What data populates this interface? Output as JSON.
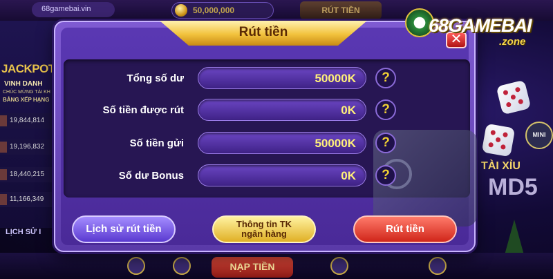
{
  "topbar": {
    "site": "68gamebai.vin",
    "balance": "50,000,000",
    "withdraw_tab": "RÚT TIỀN"
  },
  "left_panel": {
    "jackpot": "JACKPOT",
    "vinh_danh": "VINH DANH",
    "chuc_mung": "CHÚC MỪNG TÀI KH",
    "bang_xep_hang": "BẢNG XẾP HẠNG",
    "leaderboard": [
      "19,844,814",
      "19,196,832",
      "18,440,215",
      "11,166,349"
    ],
    "history": "LỊCH SỬ I"
  },
  "right_scene": {
    "tai_xiu": "TÀI XỈU",
    "md5": "MD5",
    "mini": "MINI"
  },
  "bottom_bar": {
    "nap_tien": "NẠP TIỀN"
  },
  "logo": {
    "brand": "68GAMEBAI",
    "suffix": ".zone"
  },
  "dialog": {
    "title": "Rút tiền",
    "close": "✕",
    "rows": [
      {
        "label": "Tổng số dư",
        "value": "50000K",
        "help": "?"
      },
      {
        "label": "Số tiền được rút",
        "value": "0K",
        "help": "?"
      },
      {
        "label": "Số tiền gửi",
        "value": "50000K",
        "help": "?"
      },
      {
        "label": "Số dư Bonus",
        "value": "0K",
        "help": "?"
      }
    ],
    "buttons": {
      "history": "Lịch sử rút tiền",
      "bank_line1": "Thông tin TK",
      "bank_line2": "ngân hàng",
      "withdraw": "Rút tiền"
    }
  },
  "colors": {
    "dialog_purple": "#5a38b3",
    "title_gold": "#f2c23d",
    "value_yellow": "#fff07a",
    "withdraw_red": "#d0261a",
    "history_violet": "#5a3ad0"
  }
}
